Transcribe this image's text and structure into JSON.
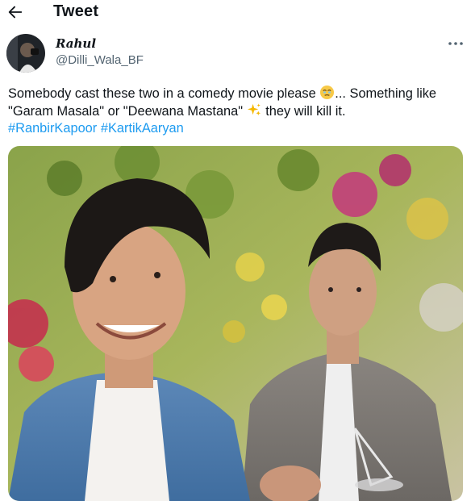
{
  "header": {
    "title": "Tweet",
    "back_icon": "arrow-left-icon"
  },
  "author": {
    "display_name": "Rahul",
    "handle": "@Dilli_Wala_BF"
  },
  "tweet": {
    "line1_text": "Somebody cast these two in a comedy movie please ",
    "line1_emoji": "face-holding-back-tears-icon",
    "line1_after": "... Something like",
    "line2_text": "\"Garam Masala\" or \"Deewana Mastana\" ",
    "line2_emoji": "sparkles-icon",
    "line2_after": " they will kill it.",
    "hashtags": [
      "#RanbirKapoor",
      "#KartikAaryan"
    ]
  },
  "icons": {
    "more": "more-horizontal-icon"
  },
  "colors": {
    "link": "#1d9bf0",
    "secondary_text": "#536471",
    "text": "#0f1419"
  }
}
